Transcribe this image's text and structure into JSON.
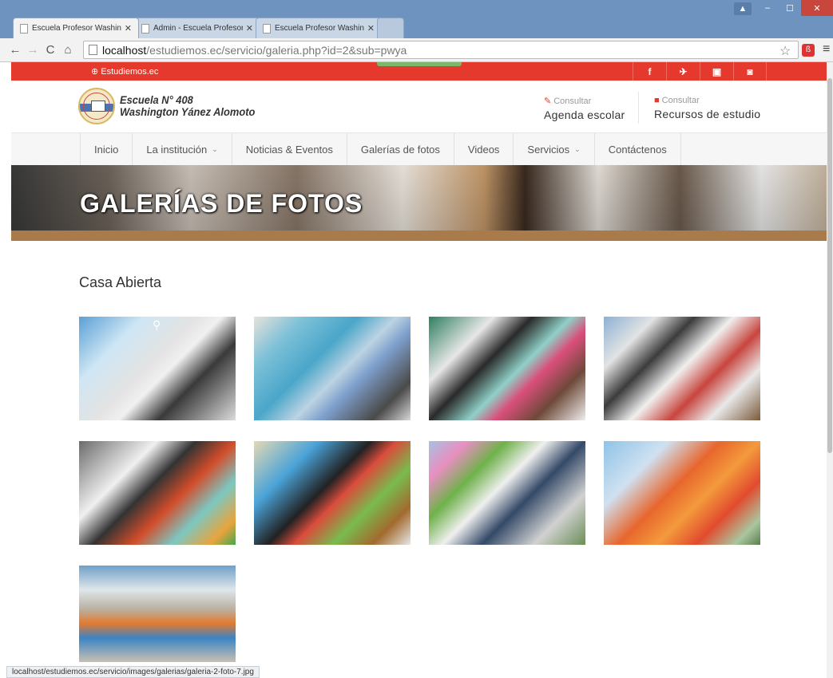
{
  "browser": {
    "tabs": [
      {
        "title": "Escuela Profesor Washing",
        "active": true
      },
      {
        "title": "Admin - Escuela Profesor",
        "active": false
      },
      {
        "title": "Escuela Profesor Washing",
        "active": false
      }
    ],
    "url_host": "localhost",
    "url_path": "/estudiemos.ec/servicio/galeria.php?id=2&sub=pwya",
    "status_text": "localhost/estudiemos.ec/servicio/images/galerias/galeria-2-foto-7.jpg"
  },
  "topbar": {
    "brand": "Estudiemos.ec",
    "accent_color": "#e4392c",
    "social": [
      "facebook-icon",
      "twitter-icon",
      "youtube-icon",
      "instagram-icon"
    ]
  },
  "header": {
    "school_line1": "Escuela N° 408",
    "school_line2": "Washington Yánez Alomoto",
    "quick1_small": "Consultar",
    "quick1_big": "Agenda escolar",
    "quick2_small": "Consultar",
    "quick2_big": "Recursos de estudio"
  },
  "nav": {
    "items": [
      {
        "label": "Inicio"
      },
      {
        "label": "La institución"
      },
      {
        "label": "Noticias & Eventos"
      },
      {
        "label": "Galerías de fotos"
      },
      {
        "label": "Videos"
      },
      {
        "label": "Servicios"
      },
      {
        "label": "Contáctenos"
      }
    ]
  },
  "hero": {
    "title": "GALERÍAS DE FOTOS"
  },
  "gallery": {
    "title": "Casa Abierta",
    "photo_count": 9
  }
}
